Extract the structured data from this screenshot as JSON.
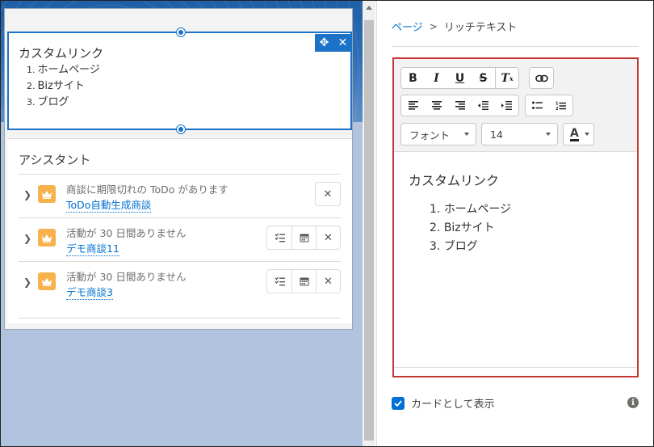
{
  "canvas": {
    "rich_text_card": {
      "title": "カスタムリンク",
      "items": [
        {
          "num": "1.",
          "label": "ホームページ"
        },
        {
          "num": "2.",
          "label": "Bizサイト"
        },
        {
          "num": "3.",
          "label": "ブログ"
        }
      ],
      "move_icon": "✥",
      "close_icon": "✕"
    },
    "assistant": {
      "title": "アシスタント",
      "rows": [
        {
          "message": "商談に期限切れの ToDo があります",
          "link": "ToDo自動生成商談"
        },
        {
          "message": "活動が 30 日間ありません",
          "link": "デモ商談11"
        },
        {
          "message": "活動が 30 日間ありません",
          "link": "デモ商談3"
        }
      ]
    }
  },
  "panel": {
    "breadcrumb": {
      "home": "ページ",
      "separator": ">",
      "current": "リッチテキスト"
    },
    "toolbar": {
      "bold": "B",
      "italic": "I",
      "underline": "U",
      "strike": "S",
      "clear_format": "Tx",
      "font_label": "フォント",
      "size_value": "14",
      "color_label": "A"
    },
    "editor_content": {
      "title": "カスタムリンク",
      "items": [
        "ホームページ",
        "Bizサイト",
        "ブログ"
      ]
    },
    "show_as_card": {
      "label": "カードとして表示",
      "checked": true
    }
  },
  "colors": {
    "accent": "#0070d2",
    "selection": "#1b72c7",
    "error_border": "#c23934",
    "crown": "#f7b24e"
  }
}
